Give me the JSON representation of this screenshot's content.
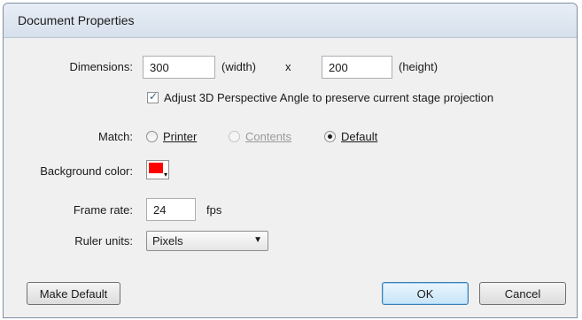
{
  "window": {
    "title": "Document Properties"
  },
  "dimensions": {
    "label": "Dimensions:",
    "width_value": "300",
    "width_unit": "(width)",
    "separator": "x",
    "height_value": "200",
    "height_unit": "(height)",
    "adjust_3d_label": "Adjust 3D Perspective Angle to preserve current stage projection",
    "adjust_3d_checked": true
  },
  "match": {
    "label": "Match:",
    "options": [
      {
        "label": "Printer",
        "selected": false,
        "enabled": true
      },
      {
        "label": "Contents",
        "selected": false,
        "enabled": false
      },
      {
        "label": "Default",
        "selected": true,
        "enabled": true
      }
    ]
  },
  "background": {
    "label": "Background color:",
    "color": "#ff0000"
  },
  "frame_rate": {
    "label": "Frame rate:",
    "value": "24",
    "unit": "fps"
  },
  "ruler_units": {
    "label": "Ruler units:",
    "selected": "Pixels"
  },
  "buttons": {
    "make_default": "Make Default",
    "ok": "OK",
    "cancel": "Cancel"
  }
}
